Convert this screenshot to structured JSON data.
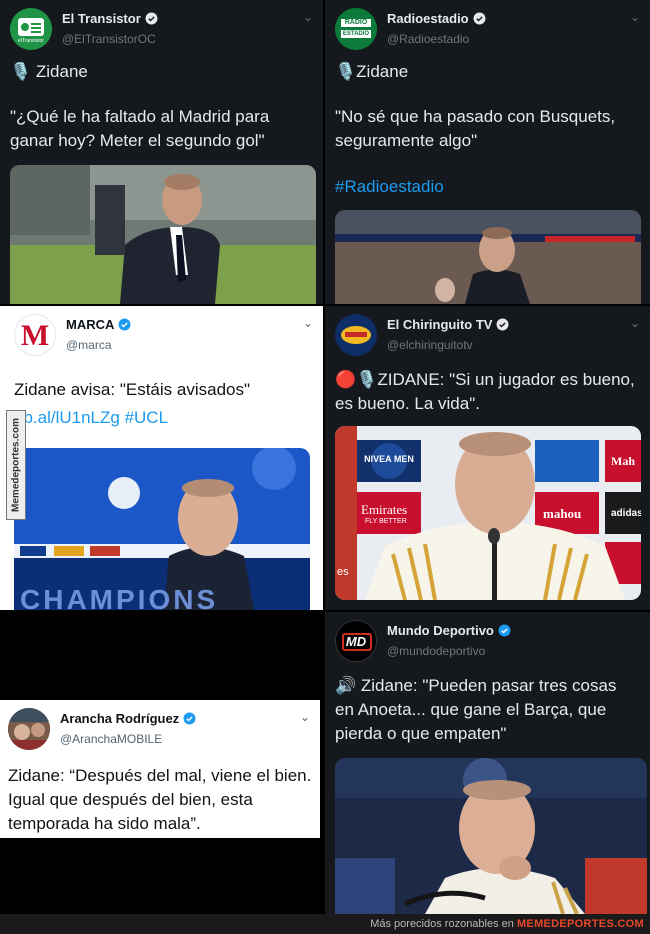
{
  "tweets": [
    {
      "name": "El Transistor",
      "handle": "@ElTransistorOC",
      "avatar_text": "elTransistor",
      "text": "🎙️ Zidane",
      "quote": "\"¿Qué le ha faltado al Madrid para ganar hoy? Meter el segundo gol\""
    },
    {
      "name": "Radioestadio",
      "handle": "@Radioestadio",
      "avatar_text_top": "RADIO",
      "avatar_text_bottom": "ESTADIO",
      "text": "🎙️Zidane",
      "quote": "\"No sé que ha pasado con Busquets, seguramente algo\"",
      "hashtag": "#Radioestadio"
    },
    {
      "name": "MARCA",
      "handle": "@marca",
      "avatar_letter": "M",
      "text": "Zidane avisa: \"Estáis avisados\"",
      "link": "ob.al/lU1nLZg",
      "hashtag": "#UCL",
      "media_text": "CHAMPIONS"
    },
    {
      "name": "El Chiringuito TV",
      "handle": "@elchiringuitotv",
      "text": "🔴🎙️ZIDANE: \"Si un jugador es bueno, es bueno. La vida\".",
      "sponsors": [
        "NIVEA MEN",
        "Emirates",
        "FLY BETTER",
        "Mah",
        "adidas",
        "mahou",
        "es"
      ]
    },
    {
      "name": "Arancha Rodríguez",
      "handle": "@AranchaMOBILE",
      "text": "Zidane: “Después del mal, viene el bien. Igual que después del bien, esta temporada ha sido mala”."
    },
    {
      "name": "Mundo Deportivo",
      "handle": "@mundodeportivo",
      "avatar_text": "MD",
      "text": "🔊 Zidane: \"Pueden pasar tres cosas en Anoeta... que gane el Barça, que pierda o que empaten\""
    }
  ],
  "watermark": "Memedeportes.com",
  "footer": {
    "prefix": "Más porecidos rozonables en",
    "brand": "MEMEDEPORTES.COM"
  },
  "colors": {
    "dark_bg": "#15181c",
    "light_bg": "#ffffff",
    "verified_blue": "#1d9bf0",
    "marca_red": "#c8102e",
    "brand_red": "#e8462b"
  }
}
